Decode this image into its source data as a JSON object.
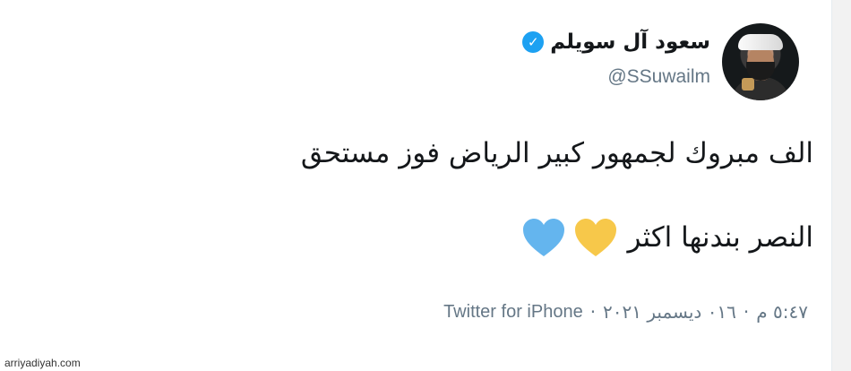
{
  "tweet": {
    "display_name": "سعود آل سويلم",
    "verified": true,
    "handle": "@SSuwailm",
    "text_line_1": "الف مبروك لجمهور كبير الرياض فوز مستحق",
    "text_line_2": "النصر بندنها اكثر",
    "emoji": [
      "yellow-heart",
      "blue-heart"
    ],
    "time": "٥:٤٧ م",
    "date": "٠١٦ ديسمبر ٢٠٢١",
    "dot": "·",
    "source": "Twitter for iPhone"
  },
  "colors": {
    "text": "#14171a",
    "meta": "#657786",
    "verified": "#1da1f2",
    "yellow_heart": "#f7c84a",
    "blue_heart": "#64b5ee"
  },
  "watermark": "arriyadiyah.com"
}
